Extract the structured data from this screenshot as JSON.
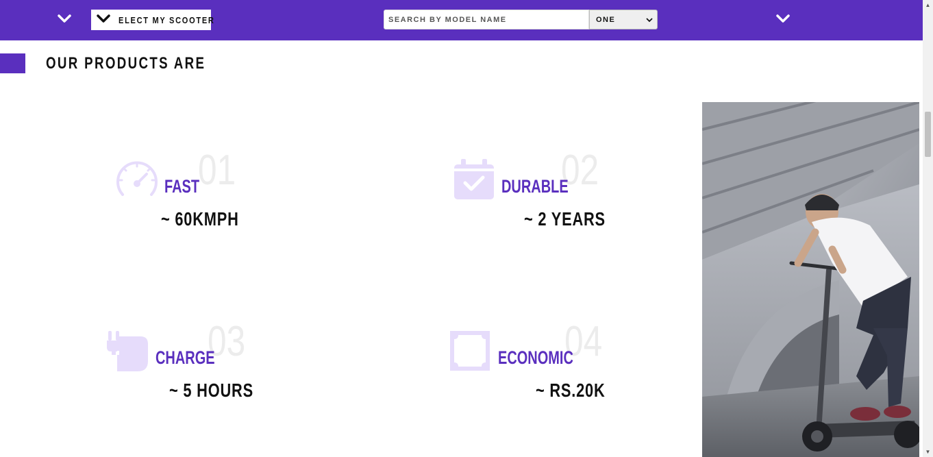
{
  "header": {
    "elect_button_label": "ELECT MY SCOOTER",
    "search_placeholder": "SEARCH BY MODEL NAME",
    "select_value": "ONE"
  },
  "section": {
    "title": "OUR PRODUCTS ARE"
  },
  "features": [
    {
      "number": "01",
      "name": "FAST",
      "value": "~ 60KMPH",
      "icon": "speedometer-icon"
    },
    {
      "number": "02",
      "name": "DURABLE",
      "value": "~ 2 YEARS",
      "icon": "calendar-check-icon"
    },
    {
      "number": "03",
      "name": "CHARGE",
      "value": "~ 5 HOURS",
      "icon": "plug-icon"
    },
    {
      "number": "04",
      "name": "ECONOMIC",
      "value": "~ RS.20K",
      "icon": "square-frame-icon"
    }
  ],
  "colors": {
    "brand": "#5a2fbe",
    "icon_tint": "#e6dcfb",
    "number_gray": "#ececec"
  },
  "image": {
    "subject": "scooter-rider-photo"
  }
}
